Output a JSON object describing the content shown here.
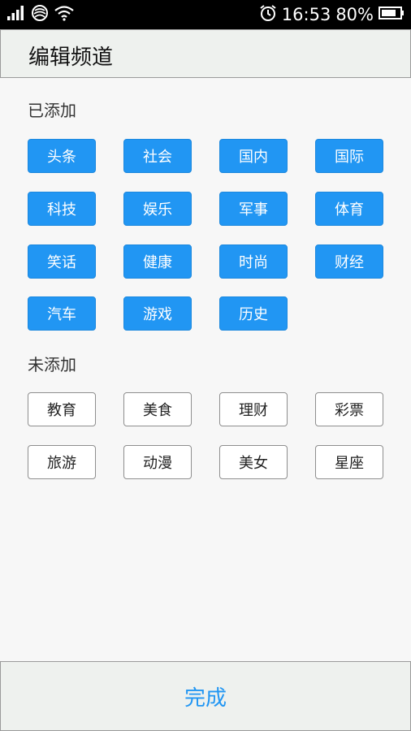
{
  "status_bar": {
    "time": "16:53",
    "battery": "80%",
    "icons": [
      "signal-icon",
      "network-icon",
      "wifi-icon",
      "alarm-icon",
      "battery-icon"
    ]
  },
  "header": {
    "title": "编辑频道"
  },
  "added": {
    "label": "已添加",
    "items": [
      "头条",
      "社会",
      "国内",
      "国际",
      "科技",
      "娱乐",
      "军事",
      "体育",
      "笑话",
      "健康",
      "时尚",
      "财经",
      "汽车",
      "游戏",
      "历史"
    ]
  },
  "unadded": {
    "label": "未添加",
    "items": [
      "教育",
      "美食",
      "理财",
      "彩票",
      "旅游",
      "动漫",
      "美女",
      "星座"
    ]
  },
  "footer": {
    "done_label": "完成"
  },
  "colors": {
    "accent": "#2196f3",
    "header_bg": "#eef1ee",
    "page_bg": "#f7f7f7",
    "status_bg": "#000000"
  }
}
